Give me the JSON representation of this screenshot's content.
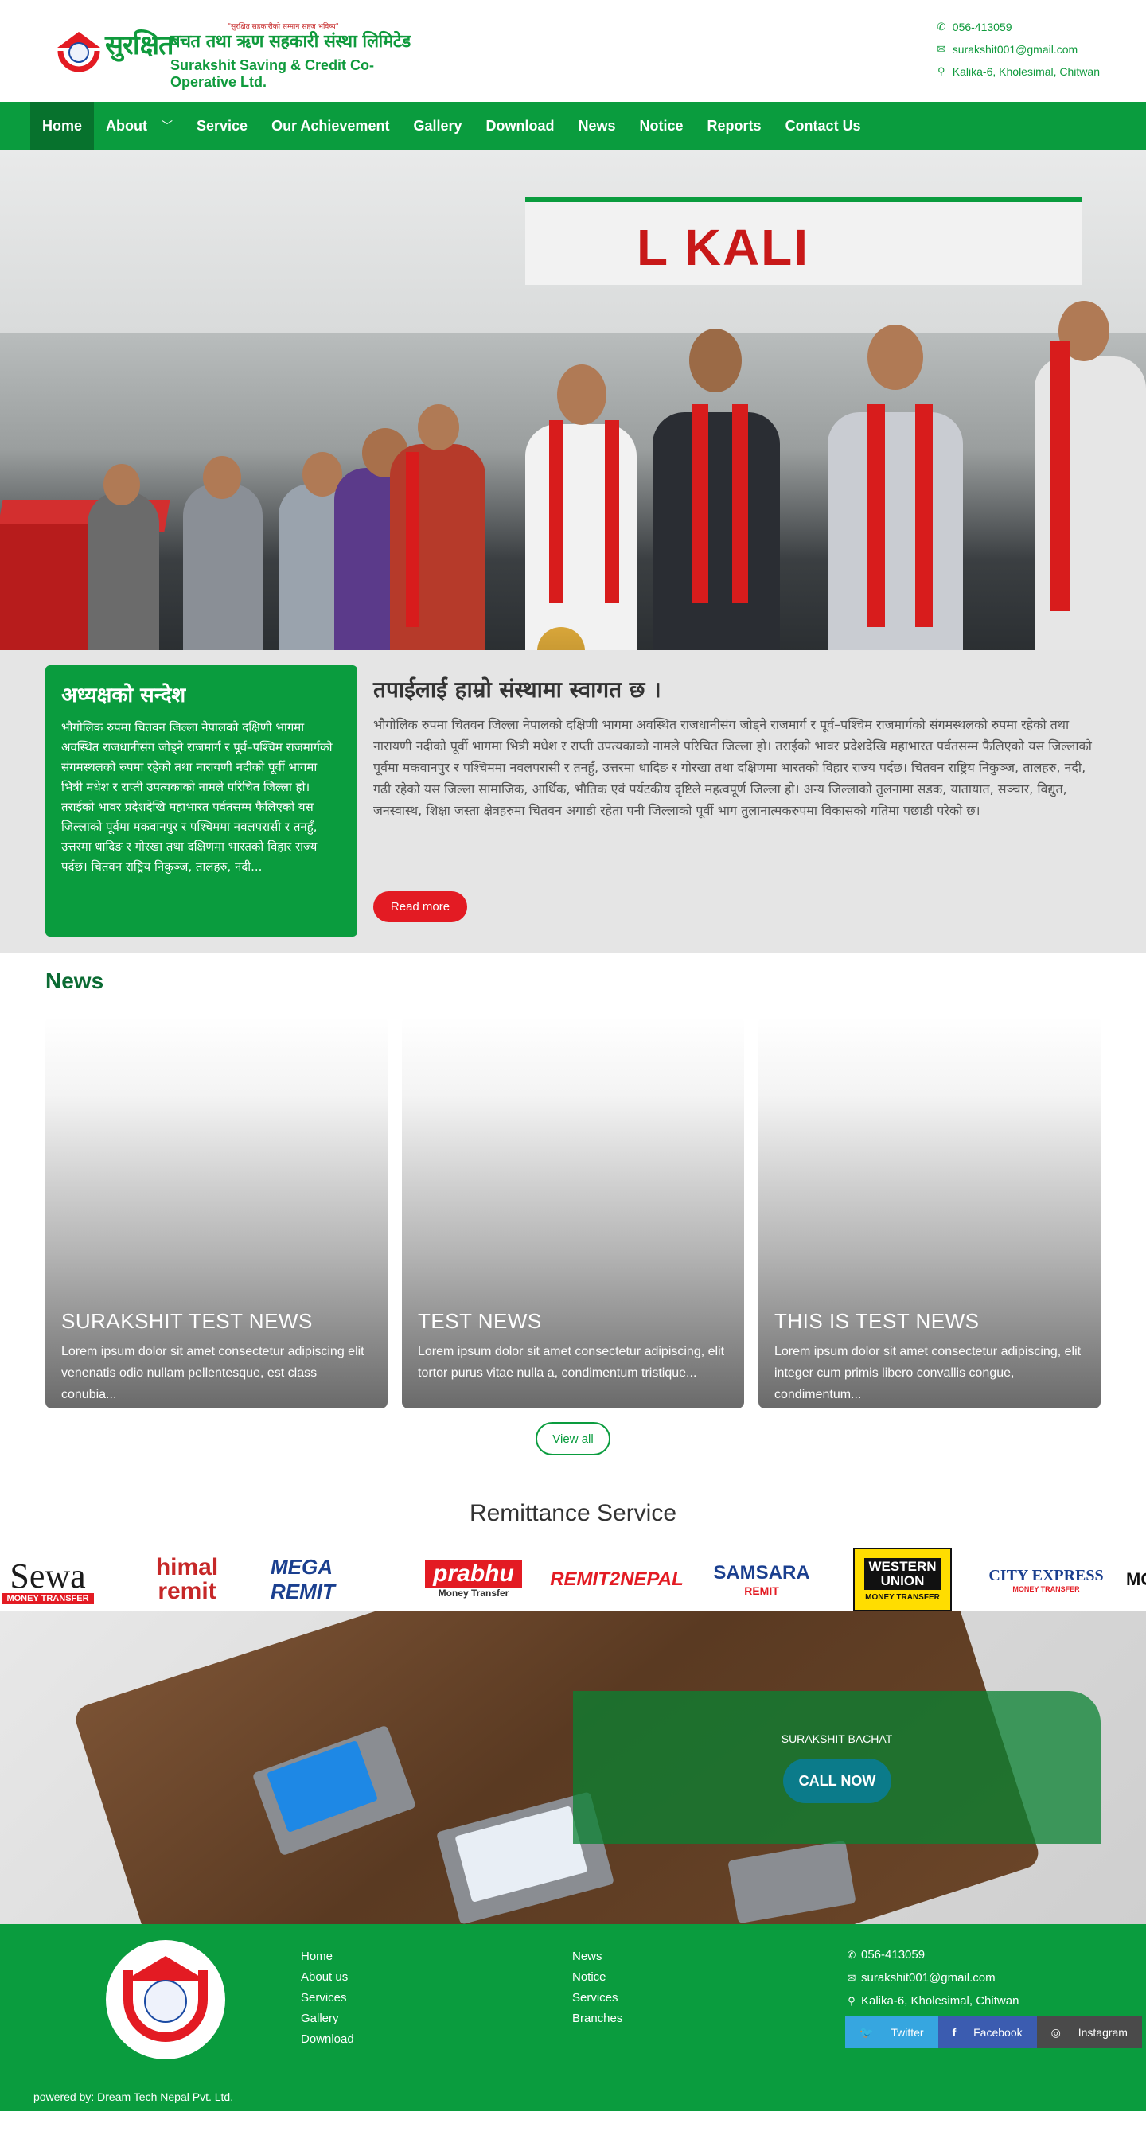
{
  "header": {
    "tagline": "\"सुरक्षित सहकारीको सम्मान सहज भविष्य\"",
    "brand_np": "सुरक्षित",
    "brand_np_sub": "बचत तथा ऋण सहकारी संस्था लिमिटेड",
    "brand_en": "Surakshit Saving & Credit Co-Operative Ltd.",
    "phone": "056-413059",
    "email": "surakshit001@gmail.com",
    "address": "Kalika-6, Kholesimal, Chitwan"
  },
  "nav": {
    "items": [
      {
        "label": "Home"
      },
      {
        "label": "About"
      },
      {
        "label": "Service"
      },
      {
        "label": "Our Achievement"
      },
      {
        "label": "Gallery"
      },
      {
        "label": "Download"
      },
      {
        "label": "News"
      },
      {
        "label": "Notice"
      },
      {
        "label": "Reports"
      },
      {
        "label": "Contact Us"
      }
    ]
  },
  "hero": {
    "banner_text": "L KALI"
  },
  "chairman": {
    "title": "अध्यक्षको सन्देश",
    "text": "भौगोलिक रुपमा चितवन जिल्ला नेपालको दक्षिणी भागमा अवस्थित राजधानीसंग जोड्ने राजमार्ग र पूर्व–पश्चिम राजमार्गको संगमस्थलको रुपमा रहेको तथा नारायणी नदीको पूर्वी भागमा भित्री मधेश र राप्ती उपत्यकाको नामले परिचित जिल्ला हो। तराईको भावर प्रदेशदेखि महाभारत पर्वतसम्म फैलिएको यस जिल्लाको पूर्वमा मकवानपुर र पश्चिममा नवलपरासी र तनहुँ, उत्तरमा धादिङ र गोरखा तथा दक्षिणमा भारतको विहार राज्य पर्दछ। चितवन राष्ट्रिय निकुञ्ज, तालहरु, नदी..."
  },
  "welcome": {
    "title": "तपाईलाई हाम्रो संस्थामा स्वागत छ ।",
    "text": "भौगोलिक रुपमा चितवन जिल्ला नेपालको दक्षिणी भागमा अवस्थित राजधानीसंग जोड्ने राजमार्ग र पूर्व–पश्चिम राजमार्गको संगमस्थलको रुपमा रहेको तथा नारायणी नदीको पूर्वी भागमा भित्री मधेश र राप्ती उपत्यकाको नामले परिचित जिल्ला हो। तराईको भावर प्रदेशदेखि महाभारत पर्वतसम्म फैलिएको यस जिल्लाको पूर्वमा मकवानपुर र पश्चिममा नवलपरासी र तनहुँ, उत्तरमा धादिङ र गोरखा तथा दक्षिणमा भारतको विहार राज्य पर्दछ। चितवन राष्ट्रिय निकुञ्ज, तालहरु, नदी, गढी रहेको यस जिल्ला सामाजिक, आर्थिक, भौतिक एवं पर्यटकीय दृष्टिले महत्वपूर्ण जिल्ला हो। अन्य जिल्लाको तुलनामा सडक, यातायात, सञ्चार, विद्युत, जनस्वास्थ, शिक्षा जस्ता क्षेत्रहरुमा चितवन अगाडी रहेता पनी जिल्लाको पूर्वी भाग तुलानात्मकरुपमा विकासको गतिमा पछाडी परेको छ।",
    "read_more": "Read more"
  },
  "news": {
    "heading": "News",
    "cards": [
      {
        "title": "SURAKSHIT TEST NEWS",
        "excerpt": "Lorem ipsum dolor sit amet consectetur adipiscing elit venenatis odio nullam pellentesque, est class conubia..."
      },
      {
        "title": "TEST NEWS",
        "excerpt": "Lorem ipsum dolor sit amet consectetur adipiscing, elit tortor purus vitae nulla a, condimentum tristique..."
      },
      {
        "title": "THIS IS TEST NEWS",
        "excerpt": "Lorem ipsum dolor sit amet consectetur adipiscing, elit integer cum primis libero convallis congue, condimentum..."
      }
    ],
    "view_all": "View all"
  },
  "remittance": {
    "heading": "Remittance Service",
    "logos": [
      {
        "main": "Sewa",
        "sub": "MONEY TRANSFER",
        "color": "#1b1b1b",
        "accent": "#e31b23"
      },
      {
        "main": "himal remit",
        "sub": "",
        "color": "#c62828",
        "accent": "#0a9c3e"
      },
      {
        "main": "MEGA REMIT",
        "sub": "",
        "color": "#1a3f8f",
        "accent": "#c62828"
      },
      {
        "main": "prabhu",
        "sub": "Money Transfer",
        "color": "#e31b23",
        "accent": "#e31b23"
      },
      {
        "main": "REMIT2NEPAL",
        "sub": "",
        "color": "#e31b23",
        "accent": "#1a3f8f"
      },
      {
        "main": "SAMSARA",
        "sub": "REMIT",
        "color": "#1a3f8f",
        "accent": "#e31b23"
      },
      {
        "main": "WESTERN UNION",
        "sub": "MONEY TRANSFER",
        "color": "#111111",
        "accent": "#ffdd00"
      },
      {
        "main": "CITY EXPRESS",
        "sub": "MONEY TRANSFER",
        "color": "#1a3f8f",
        "accent": "#e31b23"
      },
      {
        "main": "MO",
        "sub": "",
        "color": "#111111",
        "accent": "#0a9c3e"
      }
    ]
  },
  "callnow": {
    "label": "SURAKSHIT BACHAT",
    "button": "CALL NOW"
  },
  "footer": {
    "col1": [
      "Home",
      "About us",
      "Services",
      "Gallery",
      "Download"
    ],
    "col2": [
      "News",
      "Notice",
      "Services",
      "Branches"
    ],
    "phone": "056-413059",
    "email": "surakshit001@gmail.com",
    "address": "Kalika-6, Kholesimal, Chitwan",
    "social": {
      "twitter": "Twitter",
      "facebook": "Facebook",
      "instagram": "Instagram"
    },
    "powered_by": "powered by: Dream Tech Nepal Pvt. Ltd."
  },
  "colors": {
    "brand_green": "#0a9c3e",
    "nav_active": "#07722d",
    "accent_red": "#e31b23",
    "welcome_bg": "#e5e5e5"
  }
}
